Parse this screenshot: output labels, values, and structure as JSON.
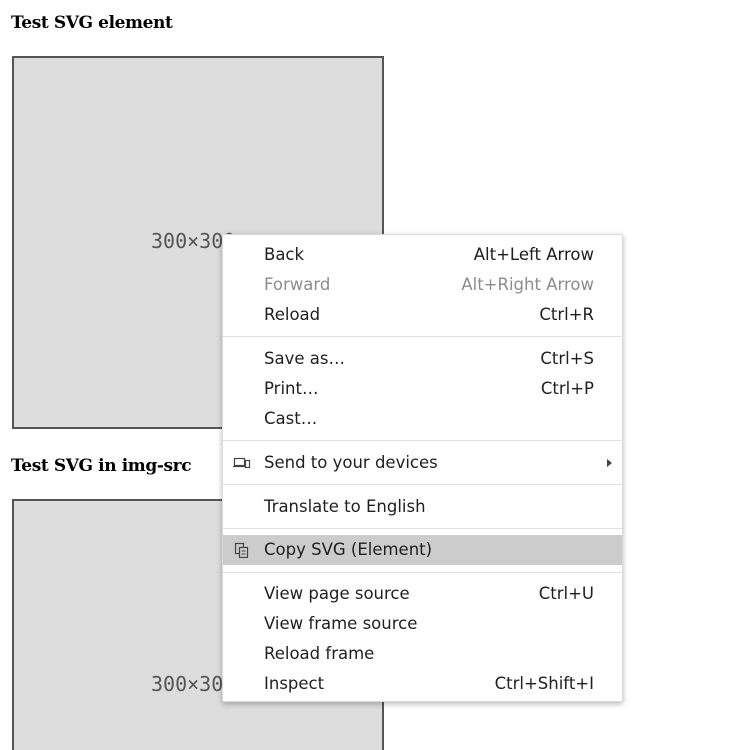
{
  "page": {
    "heading_svg_element": "Test SVG element",
    "heading_svg_img_src": "Test SVG in img-src",
    "box1_label": "300×300",
    "box2_label": "300×300"
  },
  "context_menu": {
    "back": {
      "label": "Back",
      "shortcut": "Alt+Left Arrow"
    },
    "forward": {
      "label": "Forward",
      "shortcut": "Alt+Right Arrow",
      "disabled": true
    },
    "reload": {
      "label": "Reload",
      "shortcut": "Ctrl+R"
    },
    "save_as": {
      "label": "Save as…",
      "shortcut": "Ctrl+S"
    },
    "print": {
      "label": "Print…",
      "shortcut": "Ctrl+P"
    },
    "cast": {
      "label": "Cast…"
    },
    "send_to_devices": {
      "label": "Send to your devices",
      "icon": "devices-icon",
      "has_submenu": true
    },
    "translate": {
      "label": "Translate to English"
    },
    "copy_svg": {
      "label": "Copy SVG (Element)",
      "icon": "copy-icon",
      "highlighted": true
    },
    "view_page_source": {
      "label": "View page source",
      "shortcut": "Ctrl+U"
    },
    "view_frame_source": {
      "label": "View frame source"
    },
    "reload_frame": {
      "label": "Reload frame"
    },
    "inspect": {
      "label": "Inspect",
      "shortcut": "Ctrl+Shift+I"
    }
  },
  "colors": {
    "highlight": "#cccccc",
    "disabled_text": "#8c8c8c",
    "svg_fill": "#dddddd",
    "svg_border": "#555555"
  }
}
